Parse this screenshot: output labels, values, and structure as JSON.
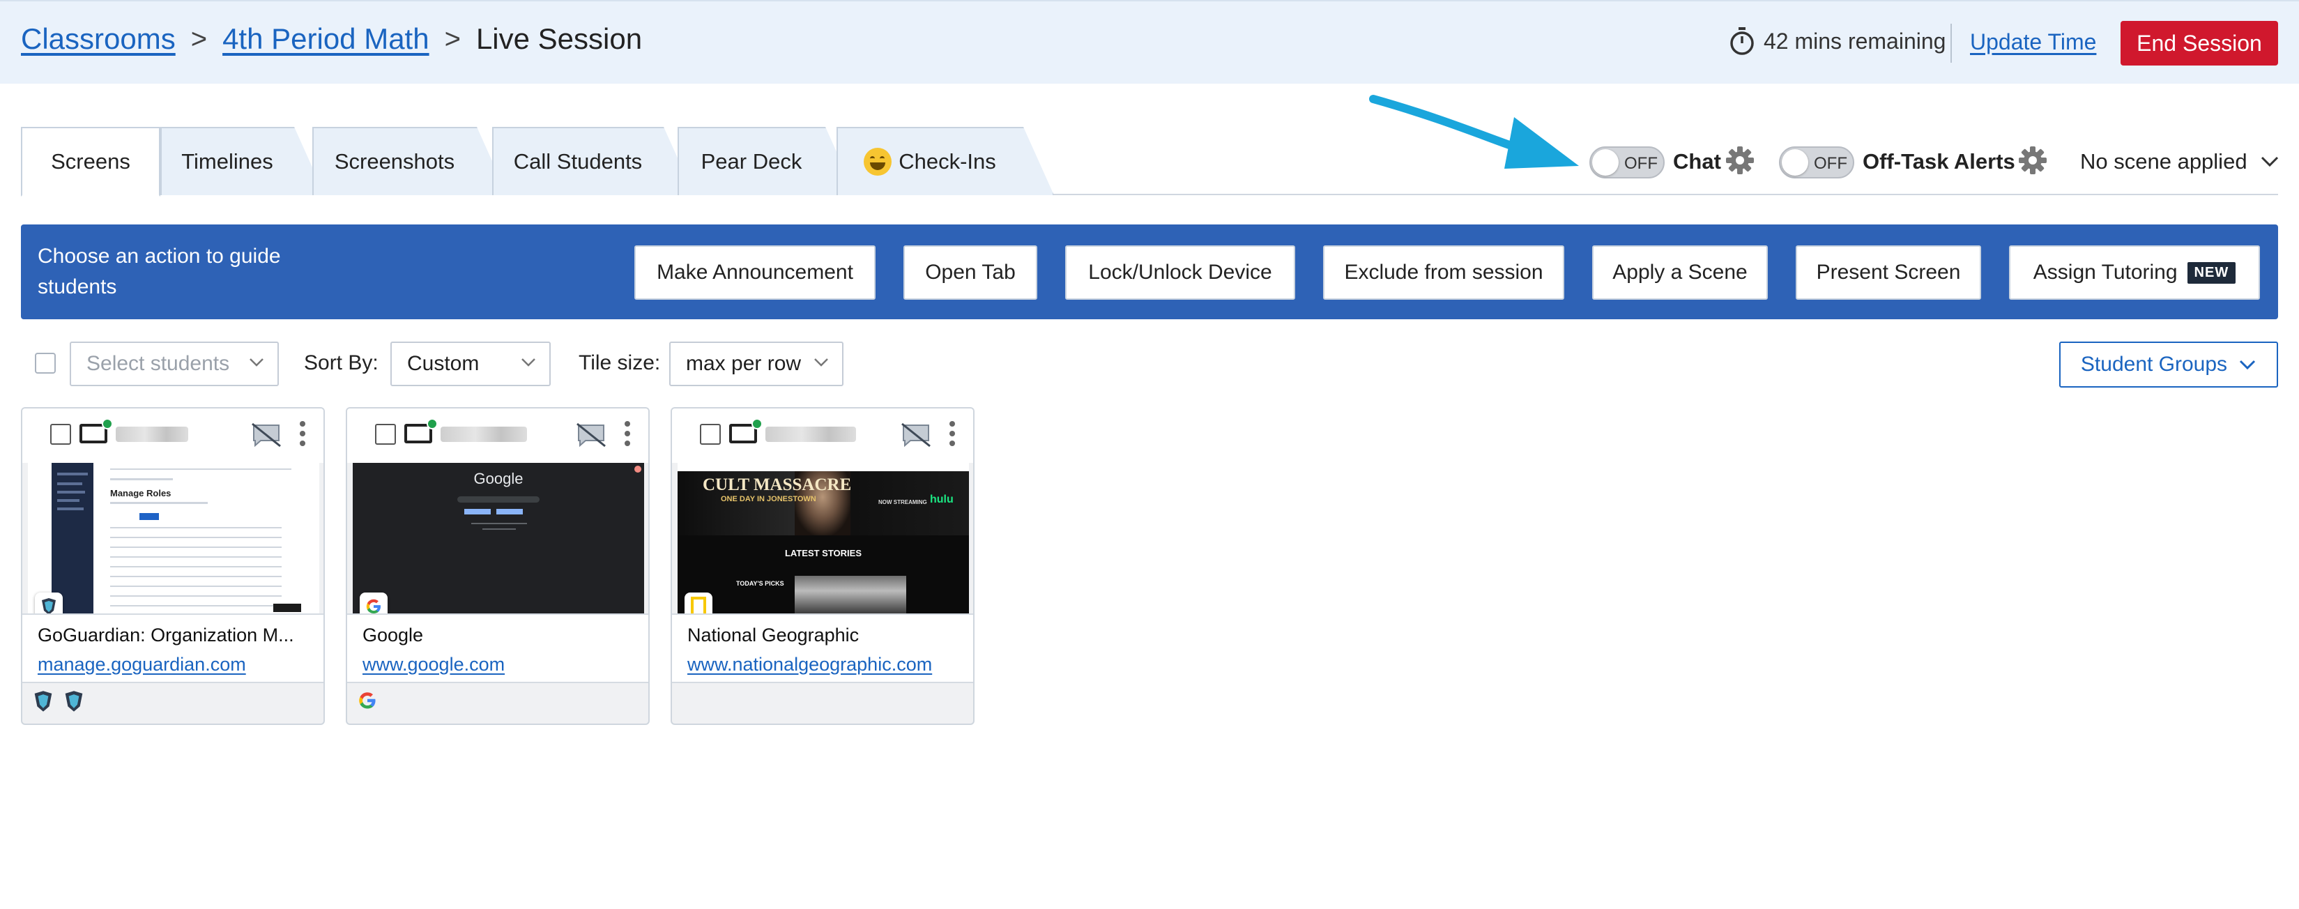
{
  "header": {
    "breadcrumbs": [
      "Classrooms",
      "4th Period Math"
    ],
    "current": "Live Session",
    "separator": ">",
    "timer_text": "42 mins remaining",
    "update_label": "Update Time",
    "end_label": "End Session"
  },
  "tabs": [
    {
      "label": "Screens",
      "active": true
    },
    {
      "label": "Timelines"
    },
    {
      "label": "Screenshots"
    },
    {
      "label": "Call Students"
    },
    {
      "label": "Pear Deck"
    },
    {
      "label": "Check-Ins",
      "icon": "grinning-face-emoji"
    }
  ],
  "toggles": {
    "chat": {
      "state": "OFF",
      "label": "Chat"
    },
    "off_task": {
      "state": "OFF",
      "label": "Off-Task Alerts"
    }
  },
  "scene": {
    "label": "No scene applied"
  },
  "action_bar": {
    "prompt": "Choose an action to guide students",
    "buttons": [
      "Make Announcement",
      "Open Tab",
      "Lock/Unlock Device",
      "Exclude from session",
      "Apply a Scene",
      "Present Screen",
      "Assign Tutoring"
    ],
    "new_badge": "NEW"
  },
  "filters": {
    "select_placeholder": "Select students",
    "sort_label": "Sort By:",
    "sort_value": "Custom",
    "tile_label": "Tile size:",
    "tile_value": "max per row",
    "groups_label": "Student Groups"
  },
  "students": [
    {
      "tab_title": "GoGuardian: Organization M...",
      "url": "manage.goguardian.com",
      "online": true
    },
    {
      "tab_title": "Google",
      "url": "www.google.com",
      "online": true
    },
    {
      "tab_title": "National Geographic",
      "url": "www.nationalgeographic.com",
      "online": true
    }
  ],
  "screens": {
    "goguardian_heading": "Manage Roles",
    "google_logo": "Google",
    "natgeo_headline": "CULT MASSACRE",
    "natgeo_tagline": "ONE DAY IN JONESTOWN",
    "natgeo_streaming": "NOW STREAMING",
    "natgeo_hulu": "hulu",
    "natgeo_latest": "LATEST STORIES",
    "natgeo_picks": "TODAY'S PICKS"
  },
  "colors": {
    "link": "#1a64c0",
    "end_button": "#d0182d",
    "action_bar": "#2e62b6",
    "header_bg": "#eaf2fb",
    "online": "#20a04c",
    "arrow": "#1aa6dc"
  }
}
